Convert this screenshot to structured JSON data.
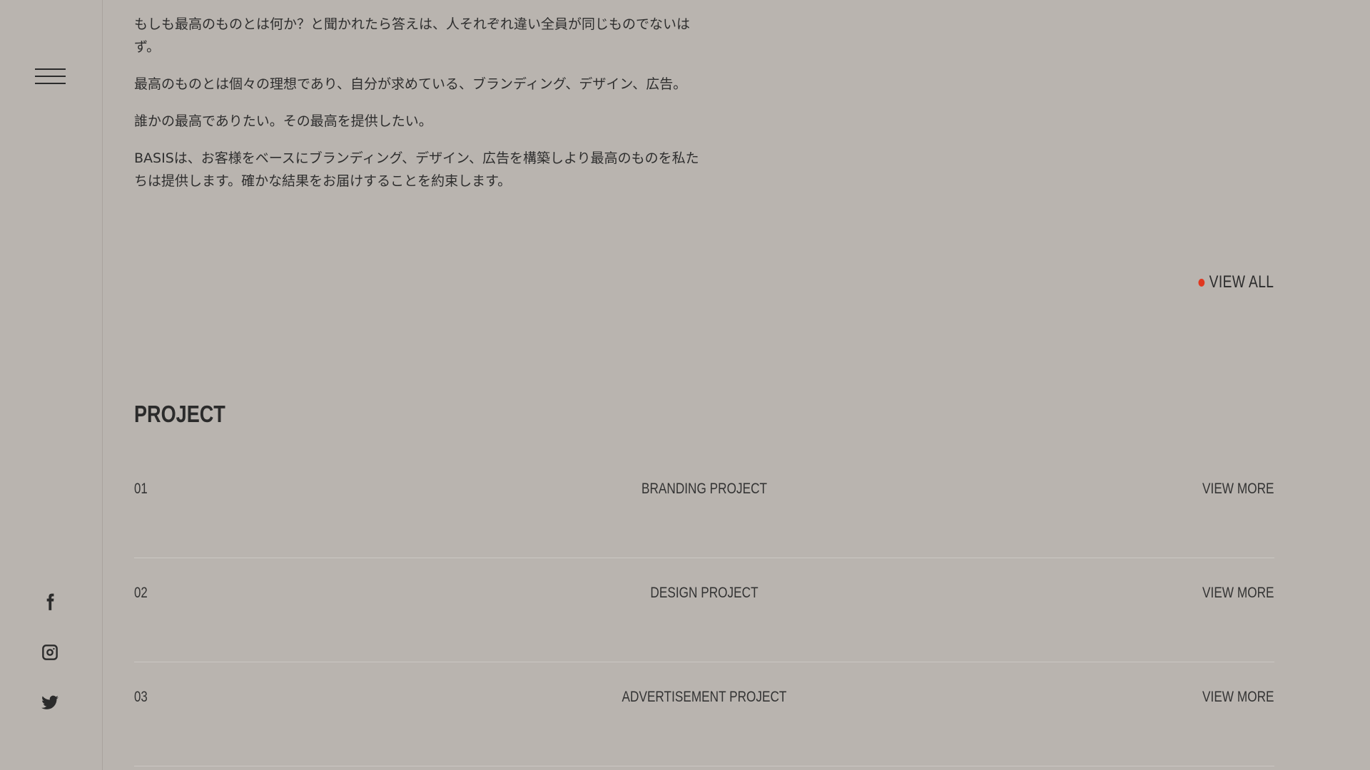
{
  "sidebar": {
    "menu_icon": "hamburger-menu-icon",
    "social": [
      {
        "icon": "facebook-icon"
      },
      {
        "icon": "instagram-icon"
      },
      {
        "icon": "twitter-icon"
      }
    ]
  },
  "intro": {
    "paragraphs": [
      "もしも最高のものとは何か？と聞かれたら答えは、人それぞれ違い全員が同じものでないはず。",
      "最高のものとは個々の理想であり、自分が求めている、ブランディング、デザイン、広告。",
      "誰かの最高でありたい。その最高を提供したい。",
      "BASISは、お客様をベースにブランディング、デザイン、広告を構築しより最高のものを私たちは提供します。確かな結果をお届けすることを約束します。"
    ]
  },
  "view_all": {
    "label": "VIEW ALL",
    "dot_color": "#e0371f"
  },
  "project": {
    "title": "PROJECT",
    "rows": [
      {
        "num": "01",
        "name": "BRANDING PROJECT",
        "more": "VIEW MORE"
      },
      {
        "num": "02",
        "name": "DESIGN PROJECT",
        "more": "VIEW MORE"
      },
      {
        "num": "03",
        "name": "ADVERTISEMENT PROJECT",
        "more": "VIEW MORE"
      }
    ]
  },
  "colors": {
    "background": "#b9b4af",
    "text": "#2b2b2b",
    "accent": "#e0371f"
  }
}
